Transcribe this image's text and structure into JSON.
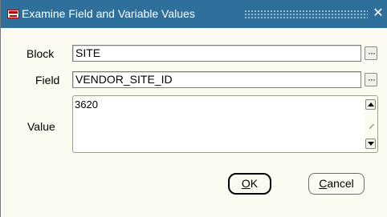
{
  "window": {
    "title": "Examine Field and Variable Values",
    "close_glyph": "✕",
    "app_icon": "oracle-forms-icon"
  },
  "form": {
    "block": {
      "label": "Block",
      "value": "SITE"
    },
    "field": {
      "label": "Field",
      "value": "VENDOR_SITE_ID"
    },
    "value": {
      "label": "Value",
      "text": "3620"
    },
    "lov_glyph": "···"
  },
  "buttons": {
    "ok": {
      "mnemonic": "O",
      "rest": "K"
    },
    "cancel": {
      "mnemonic": "C",
      "rest": "ancel"
    }
  },
  "colors": {
    "titlebar": "#2f6f9c",
    "window_bg": "#fbfbf2"
  }
}
